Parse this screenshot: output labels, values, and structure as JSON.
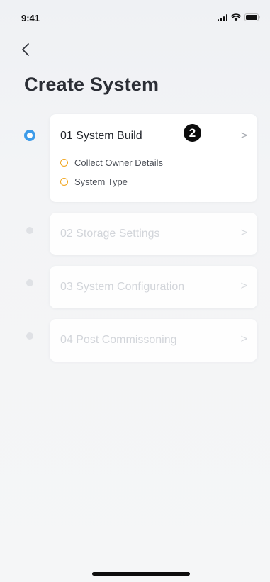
{
  "status_bar": {
    "time": "9:41"
  },
  "header": {
    "back_icon": "chevron-left-icon",
    "title": "Create System"
  },
  "steps": [
    {
      "label": "01 System Build",
      "state": "active",
      "badge": "2",
      "sub_items": [
        {
          "label": "Collect Owner Details",
          "icon": "warning-icon"
        },
        {
          "label": "System Type",
          "icon": "warning-icon"
        }
      ]
    },
    {
      "label": "02 Storage Settings",
      "state": "inactive"
    },
    {
      "label": "03 System Configuration",
      "state": "inactive"
    },
    {
      "label": "04 Post Commissoning",
      "state": "inactive"
    }
  ],
  "colors": {
    "accent": "#3d9be9",
    "warning": "#f0a41b",
    "title": "#2b2e35",
    "inactive_text": "#d2d5da"
  }
}
